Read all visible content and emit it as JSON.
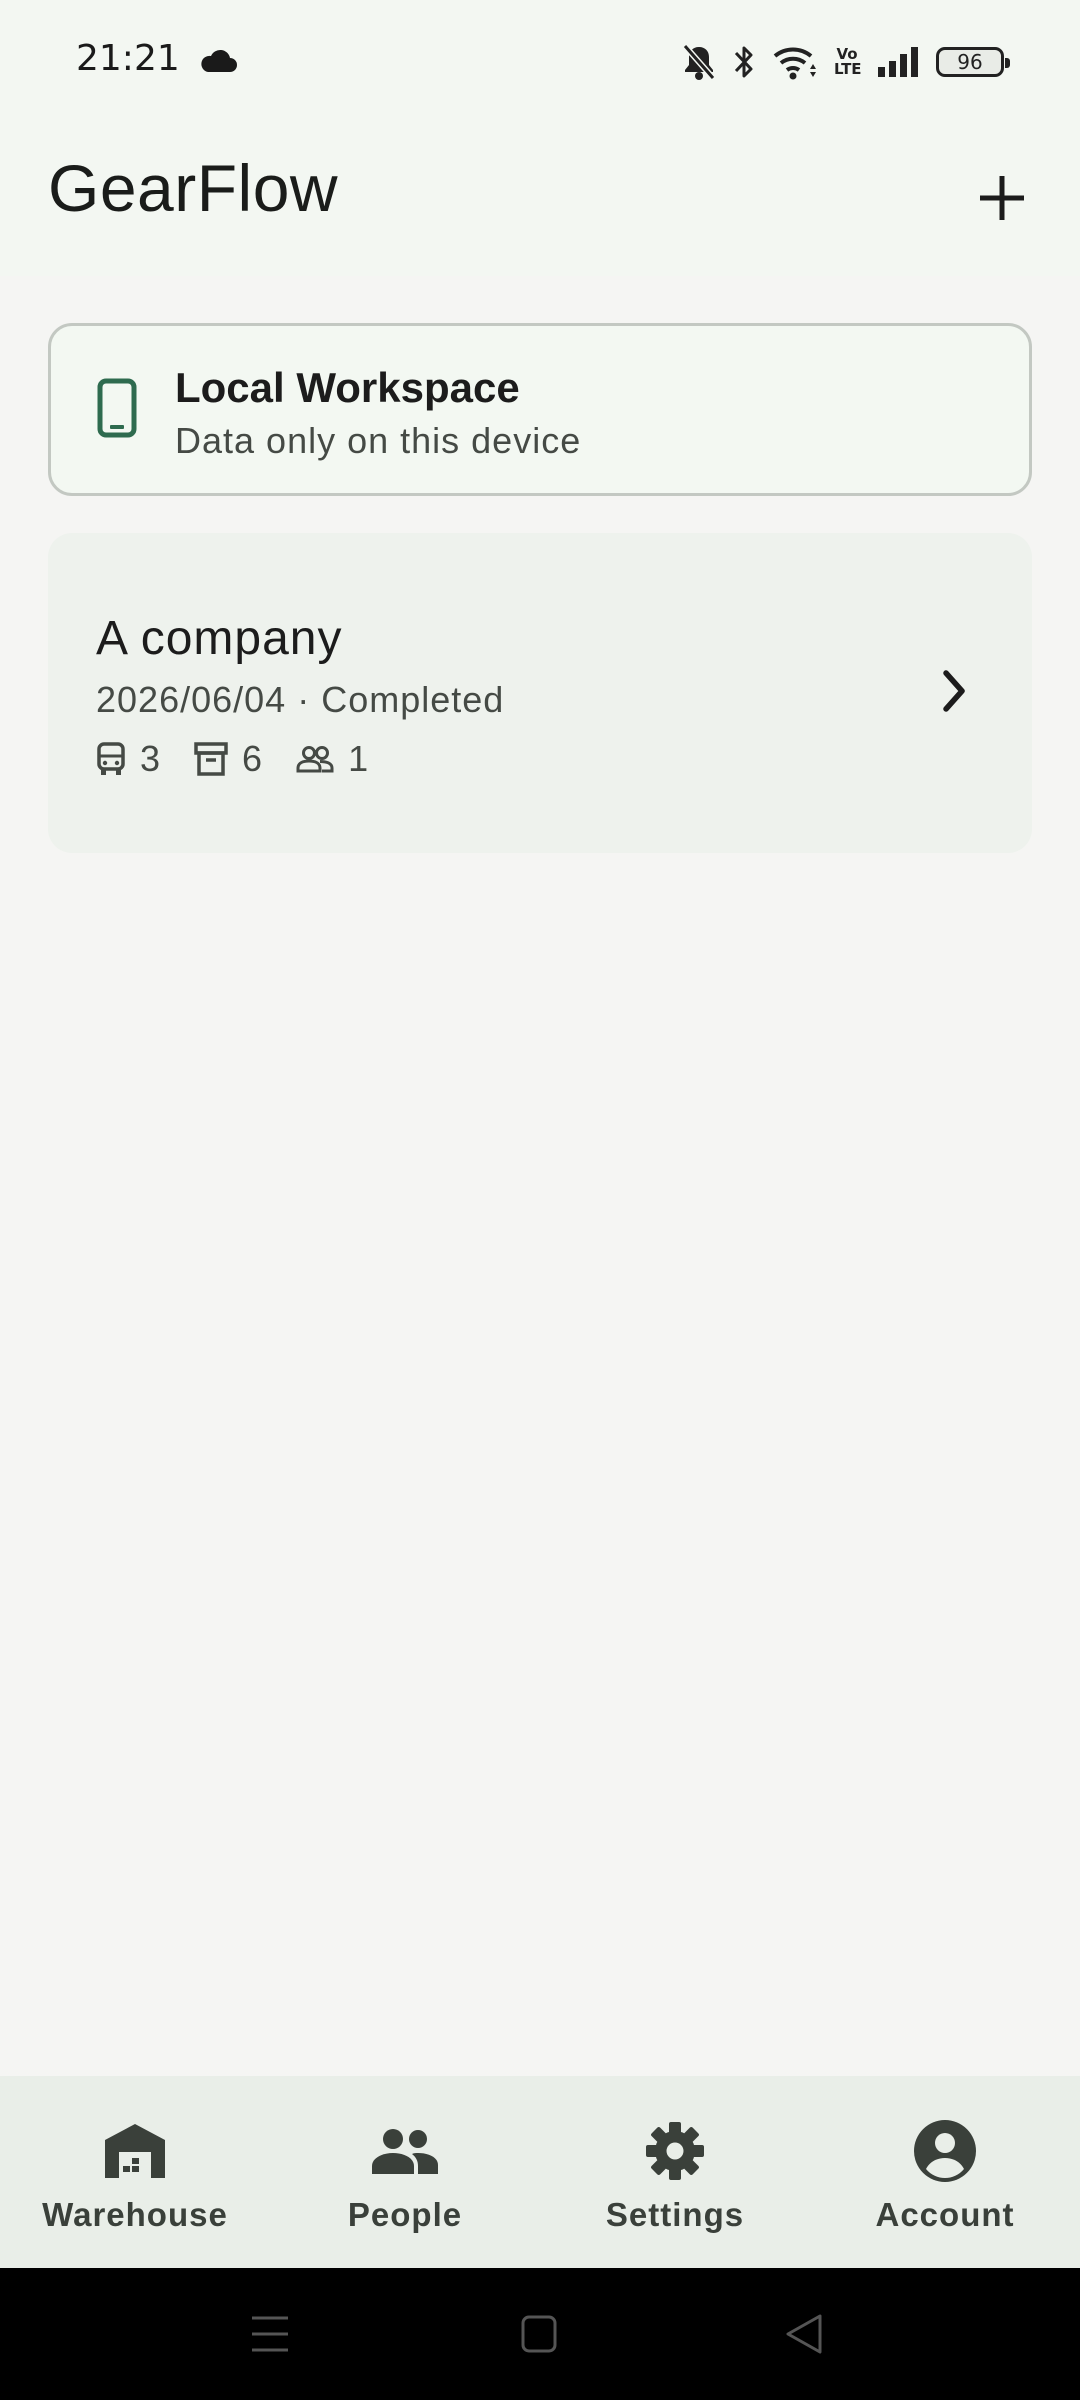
{
  "status_bar": {
    "time": "21:21",
    "icons": [
      "cloud-icon",
      "bell-off-icon",
      "bluetooth-icon",
      "wifi-icon",
      "volte-icon",
      "signal-icon",
      "battery-icon"
    ],
    "volte_top": "Vo",
    "volte_bottom": "LTE",
    "battery_level": "96"
  },
  "app_bar": {
    "title": "GearFlow",
    "add_icon": "plus-icon"
  },
  "workspace": {
    "icon": "phone-icon",
    "title": "Local Workspace",
    "subtitle": "Data only on this device"
  },
  "projects": [
    {
      "name": "A company",
      "date": "2026/06/04",
      "separator": "·",
      "status": "Completed",
      "stats": [
        {
          "icon": "bus-icon",
          "value": "3"
        },
        {
          "icon": "archive-box-icon",
          "value": "6"
        },
        {
          "icon": "people-outline-icon",
          "value": "1"
        }
      ]
    }
  ],
  "bottom_nav": {
    "items": [
      {
        "label": "Warehouse",
        "icon": "warehouse-icon"
      },
      {
        "label": "People",
        "icon": "people-icon"
      },
      {
        "label": "Settings",
        "icon": "gear-icon"
      },
      {
        "label": "Account",
        "icon": "account-circle-icon"
      }
    ]
  },
  "system_nav": {
    "buttons": [
      "menu-icon",
      "home-icon",
      "back-icon"
    ]
  },
  "colors": {
    "accent": "#2e6b4f",
    "app_bar_bg": "#f3f7f2",
    "card_bg": "#eef2ed",
    "nav_bg": "#e9eee8",
    "icon_dark": "#3a403a"
  }
}
